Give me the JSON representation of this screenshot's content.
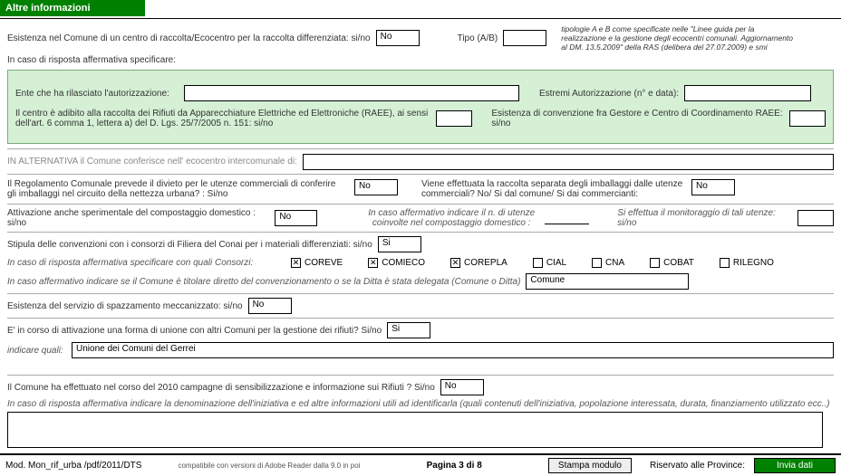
{
  "header": "Altre informazioni",
  "q1": "Esistenza nel Comune di un centro di raccolta/Ecocentro per la raccolta differenziata: si/no",
  "q1_val": "No",
  "q1_tipo": "Tipo  (A/B)",
  "q1_note": "tipologie A e B come specificate nelle \"Linee guida per la realizzazione e la gestione degli ecocentri comunali. Aggiornamento al DM. 13.5.2009\" della RAS (delibera del 27.07.2009) e smi",
  "aff_label": "In caso di risposta affermativa specificare:",
  "g1": "Ente che ha rilasciato l'autorizzazione:",
  "g2": "Estremi Autorizzazione (n° e data):",
  "g3": "Il centro è adibito alla raccolta dei Rifiuti da Apparecchiature Elettriche ed Elettroniche (RAEE), ai sensi dell'art. 6 comma 1, lettera a) del D. Lgs. 25/7/2005 n. 151:   si/no",
  "g4": "Esistenza di convenzione fra Gestore e Centro di Coordinamento RAEE: si/no",
  "alt": "IN ALTERNATIVA  il Comune conferisce nell' ecocentro intercomunale  di:",
  "q2a": "Il Regolamento Comunale prevede il  divieto per le utenze commerciali di conferire gli imballaggi nel circuito della nettezza urbana?  : Si/no",
  "q2a_val": "No",
  "q2b": "Viene effettuata la raccolta separata degli imballaggi dalle utenze commerciali? No/ Si dal comune/ Si dai commercianti:",
  "q2b_val": "No",
  "q3": "Attivazione anche sperimentale del compostaggio domestico : si/no",
  "q3_val": "No",
  "q3_hint": "In caso affermativo indicare il n. di utenze coinvolte nel compostaggio domestico :",
  "q3_right": "Si effettua il monitoraggio  di tali utenze:  si/no",
  "q4": "Stipula delle convenzioni con i consorzi di Filiera del Conai per i materiali differenziati: si/no",
  "q4_val": "Si",
  "cb_label": "In caso di risposta affermativa specificare con quali Consorzi:",
  "cb": [
    "COREVE",
    "COMIECO",
    "COREPLA",
    "CIAL",
    "CNA",
    "COBAT",
    "RILEGNO"
  ],
  "cb_checked": [
    true,
    true,
    true,
    false,
    false,
    false,
    false
  ],
  "q5": "In caso affermativo indicare se il Comune è titolare diretto del convenzionamento o se la Ditta è stata delegata (Comune o Ditta)",
  "q5_val": "Comune",
  "q6": "Esistenza del servizio di spazzamento meccanizzato: si/no",
  "q6_val": "No",
  "q7": "E' in corso di attivazione una forma di unione con altri Comuni per la gestione dei rifiuti? Si/no",
  "q7_val": "Si",
  "q7_sub": "indicare quali:",
  "q7_sub_val": "Unione dei Comuni del Gerrei",
  "q8": "Il Comune ha effettuato nel corso del 2010  campagne di sensibilizzazione e informazione sui Rifiuti ? Si/no",
  "q8_val": "No",
  "q8_sub": "In caso di risposta affermativa indicare la denominazione dell'iniziativa e  ed altre informazioni utili ad identificarla (quali contenuti dell'iniziativa, popolazione interessata, durata, finanziamento utilizzato ecc..)",
  "footer": {
    "left": "Mod. Mon_rif_urba /pdf/2011/DTS",
    "compat": "compatibile con versioni di Adobe Reader dalla 9.0 in poi",
    "page": "Pagina 3 di 8",
    "stampa": "Stampa modulo",
    "riservato": "Riservato alle  Province:",
    "invia": "Invia dati"
  }
}
